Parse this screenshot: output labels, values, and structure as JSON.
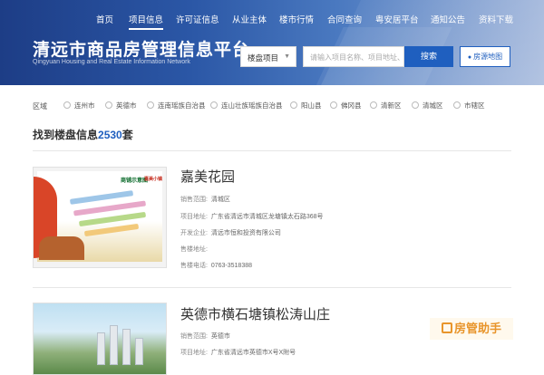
{
  "nav": {
    "items": [
      "首页",
      "项目信息",
      "许可证信息",
      "从业主体",
      "楼市行情",
      "合同查询",
      "粤安居平台",
      "通知公告",
      "资料下载"
    ],
    "active_index": 1
  },
  "header": {
    "title": "清远市商品房管理信息平台",
    "subtitle": "Qingyuan Housing and Real Estate Information Network"
  },
  "search": {
    "select_value": "楼盘项目",
    "placeholder": "请输入项目名称、项目地址、开",
    "button_label": "搜索",
    "map_button_label": "房源地图"
  },
  "filter": {
    "label": "区域",
    "districts": [
      "连州市",
      "英德市",
      "连南瑶族自治县",
      "连山壮族瑶族自治县",
      "阳山县",
      "佛冈县",
      "清新区",
      "清城区",
      "市辖区"
    ]
  },
  "results": {
    "prefix": "找到楼盘信息",
    "count": "2530",
    "suffix": "套"
  },
  "listings": [
    {
      "name": "嘉美花园",
      "fields": [
        {
          "key": "销售范围:",
          "value": "清城区"
        },
        {
          "key": "项目地址:",
          "value": "广东省清远市清城区龙塘镇太石路368号"
        },
        {
          "key": "开发企业:",
          "value": "清远市恒和投资有限公司"
        },
        {
          "key": "售楼地址:",
          "value": ""
        },
        {
          "key": "售楼电话:",
          "value": "0763-3518388"
        }
      ],
      "image_labels": [
        "商铺示意图",
        "嘉美小镇"
      ]
    },
    {
      "name": "英德市横石塘镇松涛山庄",
      "fields": [
        {
          "key": "销售范围:",
          "value": "英德市"
        },
        {
          "key": "项目地址:",
          "value": "广东省清远市英德市X号X附号"
        }
      ]
    }
  ],
  "watermark": "房管助手",
  "colors": {
    "accent": "#1f5fbf",
    "header_start": "#1d3d86",
    "watermark": "#e8952b"
  }
}
